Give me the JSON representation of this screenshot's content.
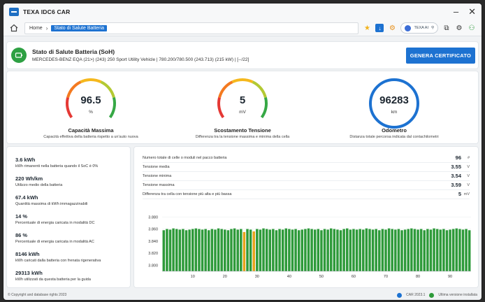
{
  "window": {
    "title": "TEXA IDC6 CAR"
  },
  "nav": {
    "breadcrumb": [
      "Home",
      "Stato di Salute Batteria"
    ],
    "user_label": "TEXA AI"
  },
  "header": {
    "title": "Stato di Salute Batteria (SoH)",
    "subtitle": "MERCEDES-BENZ EQA (21>) (243) 250 Sport Utility Vehicle | 780.200/780.500 (243.713) (215 kW) | [--/22]",
    "cert_button": "GENERA CERTIFICATO"
  },
  "gauges": [
    {
      "value": "96.5",
      "unit": "%",
      "title": "Capacità Massima",
      "desc": "Capacità effettiva della batteria rispetto a un'auto nuova",
      "style": "rainbow",
      "level": 0.965
    },
    {
      "value": "5",
      "unit": "mV",
      "title": "Scostamento Tensione",
      "desc": "Differenza tra la tensione massima e minima della cella",
      "style": "rainbow",
      "level": 0.08
    },
    {
      "value": "96283",
      "unit": "km",
      "title": "Odometro",
      "desc": "Distanza totale percorsa indicata dal contachilometri",
      "style": "blue",
      "level": 1.0
    }
  ],
  "stats": [
    {
      "value": "3.6 kWh",
      "desc": "kWh rimanenti nella batteria quando il SoC è 0%"
    },
    {
      "value": "220 Wh/km",
      "desc": "Utilizzo medio della batteria"
    },
    {
      "value": "67.4 kWh",
      "desc": "Quantità massima di kWh immagazzinabili"
    },
    {
      "value": "14 %",
      "desc": "Percentuale di energia caricata in modalità DC"
    },
    {
      "value": "86 %",
      "desc": "Percentuale di energia caricata in modalità AC"
    },
    {
      "value": "8146 kWh",
      "desc": "kWh caricati dalla batteria con frenata rigenerativa"
    },
    {
      "value": "29313 kWh",
      "desc": "kWh utilizzati da questa batteria per la guida"
    }
  ],
  "details": [
    {
      "label": "Numero totale di celle o moduli nel pacco batteria",
      "value": "96",
      "unit": "#"
    },
    {
      "label": "Tensione media",
      "value": "3.55",
      "unit": "V"
    },
    {
      "label": "Tensione minima",
      "value": "3.54",
      "unit": "V"
    },
    {
      "label": "Tensione massima",
      "value": "3.59",
      "unit": "V"
    },
    {
      "label": "Differenza tra cella con tensione più alta e più bassa",
      "value": "5",
      "unit": "mV"
    }
  ],
  "colors": {
    "accent": "#1d72d1",
    "bar_normal": "#2e9a3a",
    "bar_highlight": "#e8a21a",
    "battery_icon": "#2ea043"
  },
  "chart_data": {
    "type": "bar",
    "ylim": [
      3.79,
      3.885
    ],
    "y_ticks": [
      "3.880",
      "3.860",
      "3.840",
      "3.820",
      "3.800"
    ],
    "y_tick_values": [
      3.88,
      3.86,
      3.84,
      3.82,
      3.8
    ],
    "x_ticks": [
      10,
      20,
      30,
      40,
      50,
      60,
      70,
      80,
      90
    ],
    "highlight_cells": [
      26,
      29
    ],
    "values": [
      3.858,
      3.86,
      3.859,
      3.861,
      3.86,
      3.859,
      3.86,
      3.858,
      3.859,
      3.86,
      3.861,
      3.86,
      3.859,
      3.86,
      3.858,
      3.86,
      3.859,
      3.861,
      3.86,
      3.859,
      3.858,
      3.86,
      3.861,
      3.859,
      3.86,
      3.855,
      3.86,
      3.859,
      3.856,
      3.86,
      3.859,
      3.861,
      3.86,
      3.859,
      3.86,
      3.858,
      3.86,
      3.859,
      3.861,
      3.86,
      3.859,
      3.86,
      3.858,
      3.859,
      3.86,
      3.861,
      3.86,
      3.859,
      3.86,
      3.858,
      3.86,
      3.859,
      3.861,
      3.86,
      3.859,
      3.858,
      3.86,
      3.861,
      3.859,
      3.86,
      3.859,
      3.86,
      3.859,
      3.861,
      3.86,
      3.859,
      3.86,
      3.858,
      3.86,
      3.859,
      3.861,
      3.86,
      3.859,
      3.86,
      3.858,
      3.859,
      3.86,
      3.861,
      3.86,
      3.859,
      3.86,
      3.858,
      3.86,
      3.859,
      3.861,
      3.86,
      3.859,
      3.86,
      3.858,
      3.859,
      3.86,
      3.861,
      3.86,
      3.859,
      3.86,
      3.858
    ]
  },
  "footer": {
    "copyright": "© Copyright and database rights 2023",
    "version": "CAR 2023.1",
    "update_status": "Ultima versione installata"
  }
}
